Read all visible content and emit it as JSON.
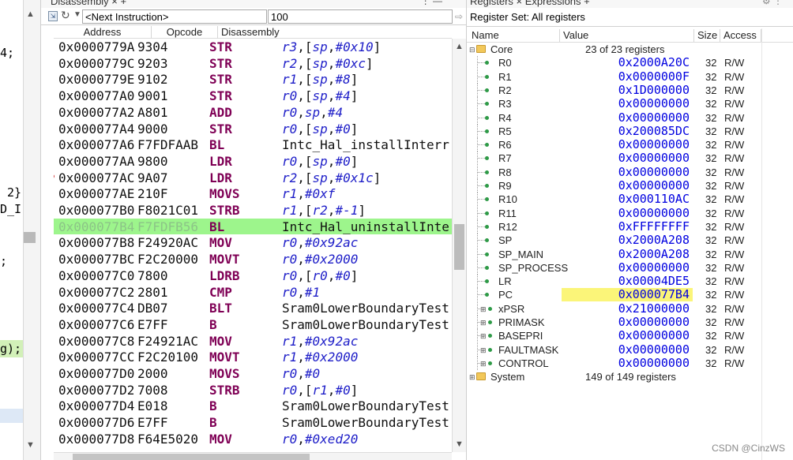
{
  "editor": {
    "line1": "4;",
    "line2": " 2},",
    "line3": "D_I",
    "line4": ";",
    "line5": "g);"
  },
  "disassembly": {
    "tab_title": "Disassembly ×  +",
    "address_field": "<Next Instruction>",
    "count_field": "100",
    "columns": {
      "address": "Address",
      "opcode": "Opcode",
      "disassembly": "Disassembly"
    },
    "rows": [
      {
        "addr": "0x0000779A",
        "op": "9304",
        "mn": "STR",
        "it": "r3",
        "pl": ",[",
        "it2": "sp",
        "pl2": ",",
        "it3": "#0x10",
        "pl3": "]"
      },
      {
        "addr": "0x0000779C",
        "op": "9203",
        "mn": "STR",
        "it": "r2",
        "pl": ",[",
        "it2": "sp",
        "pl2": ",",
        "it3": "#0xc",
        "pl3": "]"
      },
      {
        "addr": "0x0000779E",
        "op": "9102",
        "mn": "STR",
        "it": "r1",
        "pl": ",[",
        "it2": "sp",
        "pl2": ",",
        "it3": "#8",
        "pl3": "]"
      },
      {
        "addr": "0x000077A0",
        "op": "9001",
        "mn": "STR",
        "it": "r0",
        "pl": ",[",
        "it2": "sp",
        "pl2": ",",
        "it3": "#4",
        "pl3": "]"
      },
      {
        "addr": "0x000077A2",
        "op": "A801",
        "mn": "ADD",
        "it": "r0",
        "pl": ",",
        "it2": "sp",
        "pl2": ",",
        "it3": "#4",
        "pl3": ""
      },
      {
        "addr": "0x000077A4",
        "op": "9000",
        "mn": "STR",
        "it": "r0",
        "pl": ",[",
        "it2": "sp",
        "pl2": ",",
        "it3": "#0",
        "pl3": "]"
      },
      {
        "addr": "0x000077A6",
        "op": "F7FDFAAB",
        "mn": "BL",
        "text": "Intc_Hal_installInterr"
      },
      {
        "addr": "0x000077AA",
        "op": "9800",
        "mn": "LDR",
        "it": "r0",
        "pl": ",[",
        "it2": "sp",
        "pl2": ",",
        "it3": "#0",
        "pl3": "]"
      },
      {
        "addr": "0x000077AC",
        "op": "9A07",
        "mn": "LDR",
        "it": "r2",
        "pl": ",[",
        "it2": "sp",
        "pl2": ",",
        "it3": "#0x1c",
        "pl3": "]",
        "bp": true
      },
      {
        "addr": "0x000077AE",
        "op": "210F",
        "mn": "MOVS",
        "it": "r1",
        "pl": ",",
        "it2": "",
        "pl2": "",
        "it3": "#0xf",
        "pl3": ""
      },
      {
        "addr": "0x000077B0",
        "op": "F8021C01",
        "mn": "STRB",
        "it": "r1",
        "pl": ",[",
        "it2": "r2",
        "pl2": ",",
        "it3": "#-1",
        "pl3": "]"
      },
      {
        "addr": "0x000077B4",
        "op": "F7FDFB56",
        "mn": "BL",
        "text": "Intc_Hal_uninstallInte",
        "current": true
      },
      {
        "addr": "0x000077B8",
        "op": "F24920AC",
        "mn": "MOV",
        "it": "r0",
        "pl": ",",
        "it2": "",
        "pl2": "",
        "it3": "#0x92ac",
        "pl3": ""
      },
      {
        "addr": "0x000077BC",
        "op": "F2C20000",
        "mn": "MOVT",
        "it": "r0",
        "pl": ",",
        "it2": "",
        "pl2": "",
        "it3": "#0x2000",
        "pl3": ""
      },
      {
        "addr": "0x000077C0",
        "op": "7800",
        "mn": "LDRB",
        "it": "r0",
        "pl": ",[",
        "it2": "r0",
        "pl2": ",",
        "it3": "#0",
        "pl3": "]"
      },
      {
        "addr": "0x000077C2",
        "op": "2801",
        "mn": "CMP",
        "it": "r0",
        "pl": ",",
        "it2": "",
        "pl2": "",
        "it3": "#1",
        "pl3": ""
      },
      {
        "addr": "0x000077C4",
        "op": "DB07",
        "mn": "BLT",
        "text": "Sram0LowerBoundaryTest"
      },
      {
        "addr": "0x000077C6",
        "op": "E7FF",
        "mn": "B",
        "text": "Sram0LowerBoundaryTest"
      },
      {
        "addr": "0x000077C8",
        "op": "F24921AC",
        "mn": "MOV",
        "it": "r1",
        "pl": ",",
        "it2": "",
        "pl2": "",
        "it3": "#0x92ac",
        "pl3": ""
      },
      {
        "addr": "0x000077CC",
        "op": "F2C20100",
        "mn": "MOVT",
        "it": "r1",
        "pl": ",",
        "it2": "",
        "pl2": "",
        "it3": "#0x2000",
        "pl3": ""
      },
      {
        "addr": "0x000077D0",
        "op": "2000",
        "mn": "MOVS",
        "it": "r0",
        "pl": ",",
        "it2": "",
        "pl2": "",
        "it3": "#0",
        "pl3": ""
      },
      {
        "addr": "0x000077D2",
        "op": "7008",
        "mn": "STRB",
        "it": "r0",
        "pl": ",[",
        "it2": "r1",
        "pl2": ",",
        "it3": "#0",
        "pl3": "]"
      },
      {
        "addr": "0x000077D4",
        "op": "E018",
        "mn": "B",
        "text": "Sram0LowerBoundaryTest"
      },
      {
        "addr": "0x000077D6",
        "op": "E7FF",
        "mn": "B",
        "text": "Sram0LowerBoundaryTest"
      },
      {
        "addr": "0x000077D8",
        "op": "F64E5020",
        "mn": "MOV",
        "it": "r0",
        "pl": ",",
        "it2": "",
        "pl2": "",
        "it3": "#0xed20",
        "pl3": ""
      }
    ]
  },
  "registers": {
    "tab_title": "Registers ×   Expressions  +",
    "register_set_label": "Register Set:",
    "register_set_value": "All registers",
    "columns": {
      "name": "Name",
      "value": "Value",
      "size": "Size",
      "access": "Access"
    },
    "core": {
      "name": "Core",
      "count": "23 of 23 registers"
    },
    "rows": [
      {
        "name": "R0",
        "value": "0x2000A20C",
        "size": "32",
        "access": "R/W"
      },
      {
        "name": "R1",
        "value": "0x0000000F",
        "size": "32",
        "access": "R/W"
      },
      {
        "name": "R2",
        "value": "0x1D000000",
        "size": "32",
        "access": "R/W"
      },
      {
        "name": "R3",
        "value": "0x00000000",
        "size": "32",
        "access": "R/W"
      },
      {
        "name": "R4",
        "value": "0x00000000",
        "size": "32",
        "access": "R/W"
      },
      {
        "name": "R5",
        "value": "0x200085DC",
        "size": "32",
        "access": "R/W"
      },
      {
        "name": "R6",
        "value": "0x00000000",
        "size": "32",
        "access": "R/W"
      },
      {
        "name": "R7",
        "value": "0x00000000",
        "size": "32",
        "access": "R/W"
      },
      {
        "name": "R8",
        "value": "0x00000000",
        "size": "32",
        "access": "R/W"
      },
      {
        "name": "R9",
        "value": "0x00000000",
        "size": "32",
        "access": "R/W"
      },
      {
        "name": "R10",
        "value": "0x000110AC",
        "size": "32",
        "access": "R/W"
      },
      {
        "name": "R11",
        "value": "0x00000000",
        "size": "32",
        "access": "R/W"
      },
      {
        "name": "R12",
        "value": "0xFFFFFFFF",
        "size": "32",
        "access": "R/W"
      },
      {
        "name": "SP",
        "value": "0x2000A208",
        "size": "32",
        "access": "R/W"
      },
      {
        "name": "SP_MAIN",
        "value": "0x2000A208",
        "size": "32",
        "access": "R/W"
      },
      {
        "name": "SP_PROCESS",
        "value": "0x00000000",
        "size": "32",
        "access": "R/W"
      },
      {
        "name": "LR",
        "value": "0x00004DE5",
        "size": "32",
        "access": "R/W"
      },
      {
        "name": "PC",
        "value": "0x000077B4",
        "size": "32",
        "access": "R/W",
        "highlight": true
      },
      {
        "name": "xPSR",
        "value": "0x21000000",
        "size": "32",
        "access": "R/W",
        "expandable": true
      },
      {
        "name": "PRIMASK",
        "value": "0x00000000",
        "size": "32",
        "access": "R/W",
        "expandable": true
      },
      {
        "name": "BASEPRI",
        "value": "0x00000000",
        "size": "32",
        "access": "R/W",
        "expandable": true
      },
      {
        "name": "FAULTMASK",
        "value": "0x00000000",
        "size": "32",
        "access": "R/W",
        "expandable": true
      },
      {
        "name": "CONTROL",
        "value": "0x00000000",
        "size": "32",
        "access": "R/W",
        "expandable": true
      }
    ],
    "system": {
      "name": "System",
      "count": "149 of 149 registers"
    }
  },
  "watermark": "CSDN @CinzWS",
  "colors": {
    "current_line": "#9df58c",
    "mnemonic": "#7f0055",
    "operand_register": "#1e1ec8",
    "register_value": "#0000e0",
    "changed_value_bg": "#fbf579"
  }
}
